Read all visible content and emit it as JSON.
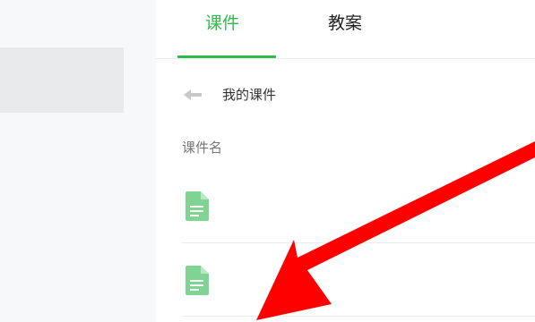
{
  "tabs": [
    {
      "label": "课件",
      "active": true
    },
    {
      "label": "教案",
      "active": false
    }
  ],
  "breadcrumb": {
    "back_label": "我的课件"
  },
  "table": {
    "column_header": "课件名",
    "rows": [
      {
        "icon": "document-icon",
        "name": ""
      },
      {
        "icon": "document-icon",
        "name": ""
      }
    ]
  },
  "colors": {
    "accent": "#2fb94b",
    "file_icon": "#7fd493",
    "annotation_arrow": "#ff0000"
  }
}
